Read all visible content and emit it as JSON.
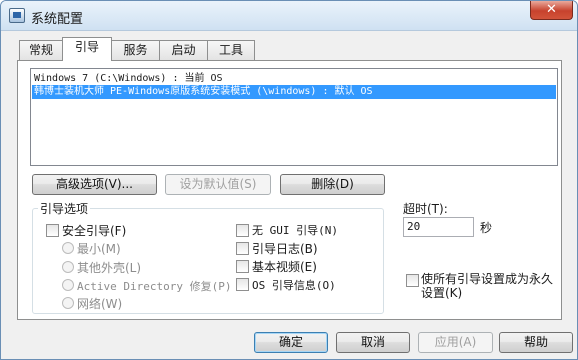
{
  "window": {
    "title": "系统配置",
    "close_symbol": "✕"
  },
  "tabs": [
    {
      "label": "常规",
      "active": false
    },
    {
      "label": "引导",
      "active": true
    },
    {
      "label": "服务",
      "active": false
    },
    {
      "label": "启动",
      "active": false
    },
    {
      "label": "工具",
      "active": false
    }
  ],
  "boot_entries": [
    {
      "text": "Windows 7 (C:\\Windows) : 当前 OS",
      "selected": false
    },
    {
      "text": "韩博士装机大师 PE-Windows原版系统安装模式 (\\windows) : 默认 OS",
      "selected": true
    }
  ],
  "buttons": {
    "advanced": "高级选项(V)...",
    "set_default": "设为默认值(S)",
    "delete": "删除(D)",
    "ok": "确定",
    "cancel": "取消",
    "apply": "应用(A)",
    "help": "帮助"
  },
  "boot_options": {
    "group_label": "引导选项",
    "safe_boot": "安全引导(F)",
    "minimal": "最小(M)",
    "alternate_shell": "其他外壳(L)",
    "active_directory": "Active Directory 修复(P)",
    "network": "网络(W)",
    "no_gui": "无 GUI 引导(N)",
    "boot_log": "引导日志(B)",
    "base_video": "基本视频(E)",
    "os_boot_info": "OS 引导信息(O)"
  },
  "timeout": {
    "label": "超时(T):",
    "value": "20",
    "unit": "秒"
  },
  "make_permanent": "使所有引导设置成为永久设置(K)"
}
